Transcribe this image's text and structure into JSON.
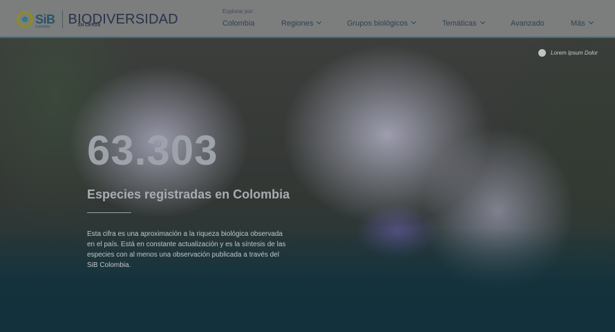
{
  "header": {
    "logo": {
      "sib": "SiB",
      "sib_sub": "Colombia",
      "title": "BIODIVERSIDAD",
      "subtitle": "EN CIFRAS"
    },
    "explore_label": "Explorar por:",
    "nav": [
      {
        "label": "Colombia",
        "has_dropdown": false
      },
      {
        "label": "Regiones",
        "has_dropdown": true
      },
      {
        "label": "Grupos biológicos",
        "has_dropdown": true
      },
      {
        "label": "Temáticas",
        "has_dropdown": true
      },
      {
        "label": "Avanzado",
        "has_dropdown": false
      },
      {
        "label": "Más",
        "has_dropdown": true
      }
    ]
  },
  "hero": {
    "photo_caption": "Lorem Ipsum Dolor",
    "number": "63.303",
    "subtitle": "Especies registradas en Colombia",
    "description": "Esta cifra es una aproximación a la riqueza biológica observada en el país. Está en constante actualización y es la síntesis de las especies con al menos una observación publicada a través del SiB Colombia."
  },
  "colors": {
    "header_bg": "#7c7d7d",
    "header_border": "#3f6b86",
    "hero_bottom": "#12313c"
  }
}
